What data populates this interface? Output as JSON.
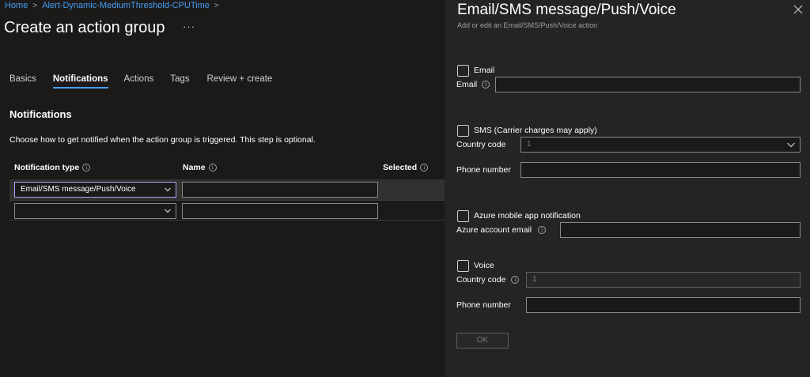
{
  "breadcrumb": {
    "home": "Home",
    "current": "Alert-Dynamic-MediumThreshold-CPUTime"
  },
  "page": {
    "title": "Create an action group",
    "more": "···"
  },
  "tabs": [
    "Basics",
    "Notifications",
    "Actions",
    "Tags",
    "Review + create"
  ],
  "notifications": {
    "heading": "Notifications",
    "description": "Choose how to get notified when the action group is triggered. This step is optional.",
    "columns": {
      "type": "Notification type",
      "name": "Name",
      "selected": "Selected"
    },
    "rows": [
      {
        "type": "Email/SMS message/Push/Voice",
        "name": ""
      },
      {
        "type": "",
        "name": ""
      }
    ]
  },
  "panel": {
    "title": "Email/SMS message/Push/Voice",
    "subtitle": "Add or edit an Email/SMS/Push/Voice action",
    "email": {
      "checkbox": "Email",
      "label": "Email",
      "value": ""
    },
    "sms": {
      "checkbox": "SMS (Carrier charges may apply)",
      "country_label": "Country code",
      "country_value": "1",
      "phone_label": "Phone number",
      "phone_value": ""
    },
    "push": {
      "checkbox": "Azure mobile app notification",
      "label": "Azure account email",
      "value": ""
    },
    "voice": {
      "checkbox": "Voice",
      "country_label": "Country code",
      "country_value": "1",
      "phone_label": "Phone number",
      "phone_value": ""
    },
    "ok": "OK"
  },
  "colors": {
    "accent": "#479ef5",
    "focus": "#b4a0ff",
    "background": "#1b1a19",
    "panel": "#252423"
  }
}
